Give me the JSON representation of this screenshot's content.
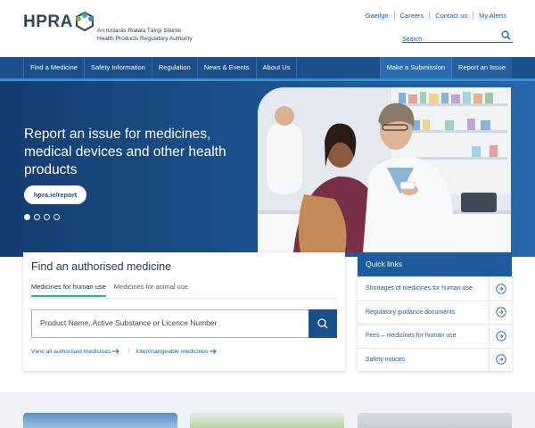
{
  "header": {
    "logo_text": "HPRA",
    "org_irish": "An tÚdarás Rialála Táirgí Sláinte",
    "org_english": "Health Products Regulatory Authority",
    "util_links": [
      "Gaeilge",
      "Careers",
      "Contact us",
      "My Alerts"
    ],
    "search_placeholder": "Search"
  },
  "nav": {
    "items": [
      "Find a Medicine",
      "Safety Information",
      "Regulation",
      "News & Events",
      "About Us"
    ],
    "right_items": [
      "Make a Submission",
      "Report an Issue"
    ]
  },
  "hero": {
    "title": "Report an issue for medicines, medical devices and other health products",
    "button": "hpra.ie/report",
    "slides": 4,
    "active_slide": 1
  },
  "find_medicine": {
    "title": "Find an authorised medicine",
    "tabs": [
      "Medicines for human use",
      "Medicines for animal use"
    ],
    "active_tab": 0,
    "search_placeholder": "Product Name, Active Substance or Licence Number",
    "links": [
      "View all authorised medicines",
      "Interchangeable medicines"
    ]
  },
  "quick_links": {
    "title": "Quick links",
    "items": [
      "Shortages of medicines for human use",
      "Regulatory guidance documents",
      "Fees – medicines for human use",
      "Safety notices"
    ]
  },
  "colors": {
    "brand_blue": "#1a4f8b",
    "accent_teal": "#2bb3a8",
    "link_blue": "#1b5fa8"
  }
}
